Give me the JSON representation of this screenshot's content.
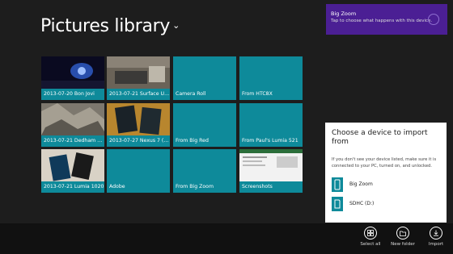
{
  "header": {
    "title": "Pictures library",
    "chevron": "⌄"
  },
  "tiles": [
    {
      "label": "2013-07-20 Bon Jovi",
      "kind": "photo"
    },
    {
      "label": "2013-07-21 Surface USB...",
      "kind": "photo"
    },
    {
      "label": "Camera Roll",
      "kind": "folder"
    },
    {
      "label": "From HTC8X",
      "kind": "folder"
    },
    {
      "label": "2013-07-21 Dedham walk",
      "kind": "photo"
    },
    {
      "label": "2013-07-27 Nexus 7 (20...",
      "kind": "photo"
    },
    {
      "label": "From Big Red",
      "kind": "folder"
    },
    {
      "label": "From Paul's Lumia 521",
      "kind": "folder"
    },
    {
      "label": "2013-07-21 Lumia 1020",
      "kind": "photo"
    },
    {
      "label": "Adobe",
      "kind": "folder"
    },
    {
      "label": "From Big Zoom",
      "kind": "folder"
    },
    {
      "label": "Screenshots",
      "kind": "photo"
    }
  ],
  "toast": {
    "title": "Big Zoom",
    "body": "Tap to choose what happens with this device."
  },
  "import_panel": {
    "title": "Choose a device to import from",
    "description": "If you don't see your device listed, make sure it is connected to your PC, turned on, and unlocked.",
    "devices": [
      {
        "label": "Big Zoom",
        "icon": "phone-icon"
      },
      {
        "label": "SDHC (D:)",
        "icon": "sd-card-icon"
      }
    ]
  },
  "appbar": {
    "select_all": "Select all",
    "new_folder": "New folder",
    "import": "Import"
  },
  "colors": {
    "accent": "#0e8a9a",
    "toast": "#4b1f94",
    "background": "#1d1d1d"
  }
}
